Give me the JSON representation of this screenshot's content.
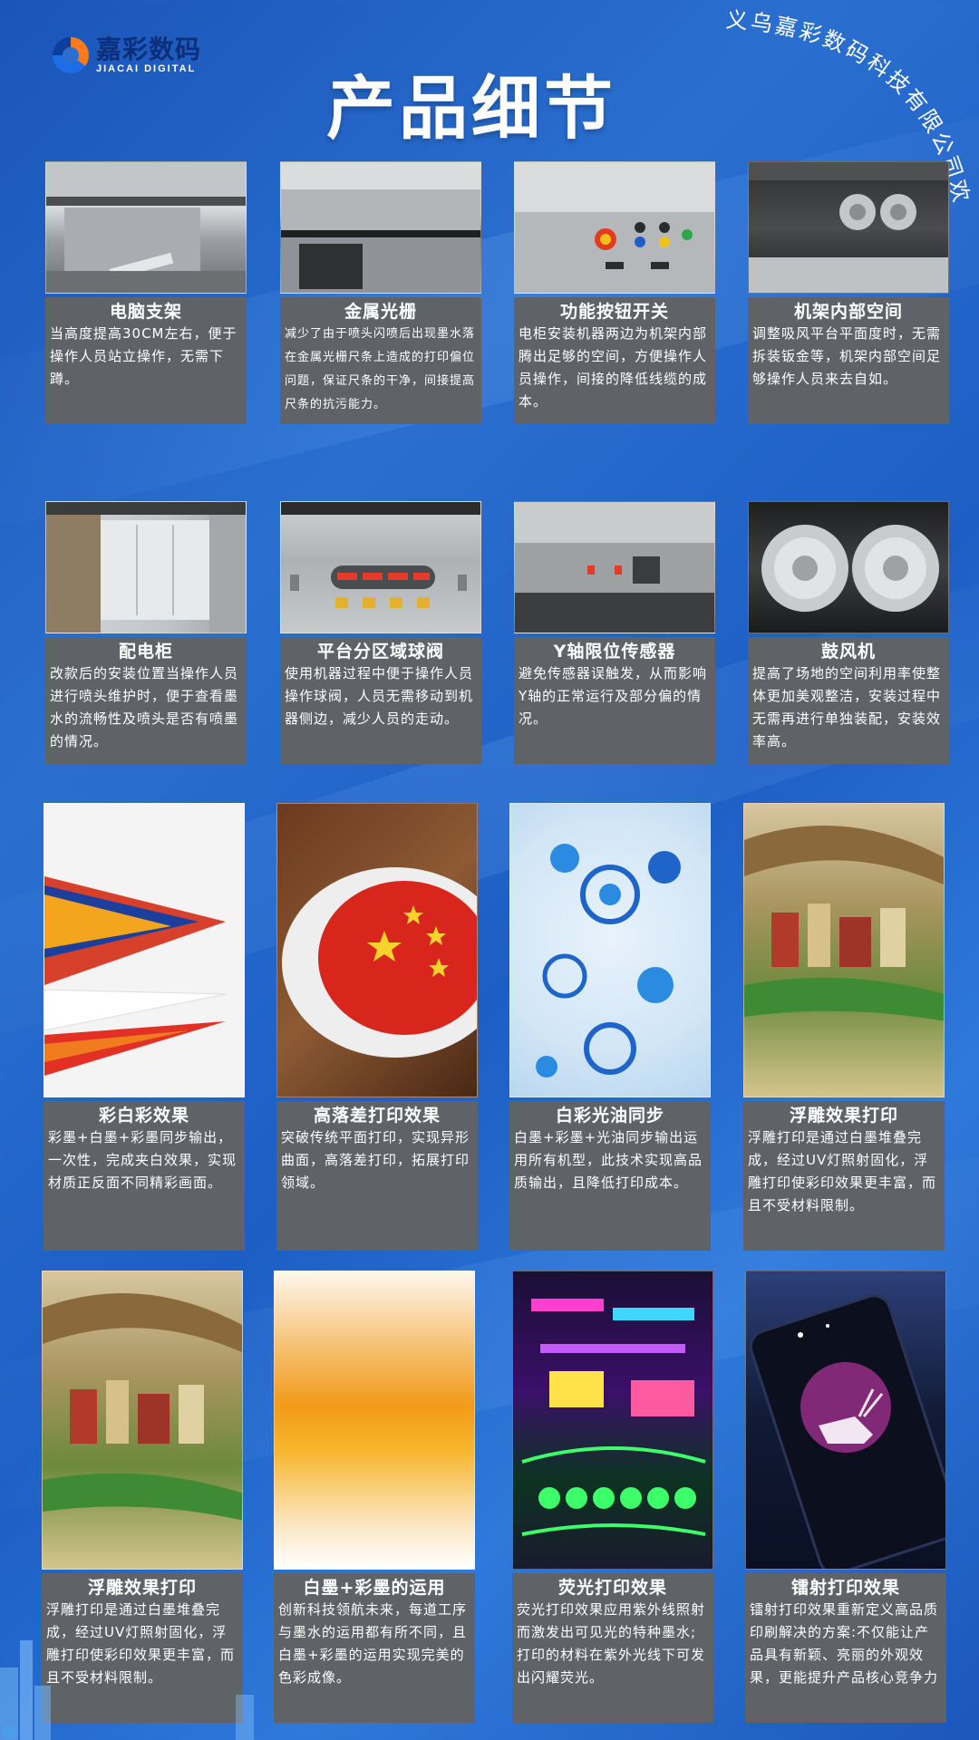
{
  "header": {
    "logo_cn": "嘉彩数码",
    "logo_en": "JIACAI DIGITAL",
    "title": "产品细节",
    "arc_text": "义乌嘉彩数码科技有限公司欢迎你"
  },
  "rows": [
    [
      {
        "name": "电脑支架",
        "desc": "当高度提高30CM左右，便于操作人员站立操作，无需下蹲。"
      },
      {
        "name": "金属光栅",
        "desc": "减少了由于喷头闪喷后出现墨水落在金属光栅尺条上造成的打印偏位问题，保证尺条的干净，间接提高尺条的抗污能力。"
      },
      {
        "name": "功能按钮开关",
        "desc": "电柜安装机器两边为机架内部腾出足够的空间，方便操作人员操作，间接的降低线缆的成本。"
      },
      {
        "name": "机架内部空间",
        "desc": "调整吸风平台平面度时，无需拆装钣金等，机架内部空间足够操作人员来去自如。"
      }
    ],
    [
      {
        "name": "配电柜",
        "desc": "改款后的安装位置当操作人员进行喷头维护时，便于查看墨水的流畅性及喷头是否有喷墨的情况。"
      },
      {
        "name": "平台分区域球阀",
        "desc": "使用机器过程中便于操作人员操作球阀，人员无需移动到机器侧边，减少人员的走动。"
      },
      {
        "name": "Y轴限位传感器",
        "desc": "避免传感器误触发，从而影响Y轴的正常运行及部分偏的情况。"
      },
      {
        "name": "鼓风机",
        "desc": "提高了场地的空间利用率使整体更加美观整洁，安装过程中无需再进行单独装配，安装效率高。"
      }
    ],
    [
      {
        "name": "彩白彩效果",
        "desc": "彩墨+白墨+彩墨同步输出，一次性，完成夹白效果，实现材质正反面不同精彩画面。"
      },
      {
        "name": "高落差打印效果",
        "desc": "突破传统平面打印，实现异形曲面，高落差打印，拓展打印领域。"
      },
      {
        "name": "白彩光油同步",
        "desc": "白墨+彩墨+光油同步输出运用所有机型，此技术实现高品质输出，且降低打印成本。"
      },
      {
        "name": "浮雕效果打印",
        "desc": "浮雕打印是通过白墨堆叠完成，经过UV灯照射固化，浮雕打印使彩印效果更丰富，而且不受材料限制。"
      }
    ],
    [
      {
        "name": "浮雕效果打印",
        "desc": "浮雕打印是通过白墨堆叠完成，经过UV灯照射固化，浮雕打印使彩印效果更丰富，而且不受材料限制。"
      },
      {
        "name": "白墨+彩墨的运用",
        "desc": "创新科技领航未来，每道工序与墨水的运用都有所不同，且白墨+彩墨的运用实现完美的色彩成像。"
      },
      {
        "name": "荧光打印效果",
        "desc": "荧光打印效果应用紫外线照射而激发出可见光的特种墨水;打印的材料在紫外光线下可发出闪耀荧光。"
      },
      {
        "name": "镭射打印效果",
        "desc": "镭射打印效果重新定义高品质印刷解决的方案:不仅能让产品具有新颖、亮丽的外观效果，更能提升产品核心竞争力"
      }
    ]
  ],
  "colors": {
    "background": "#2266c8",
    "panel": "#5f6368",
    "title": "#ffffff"
  }
}
